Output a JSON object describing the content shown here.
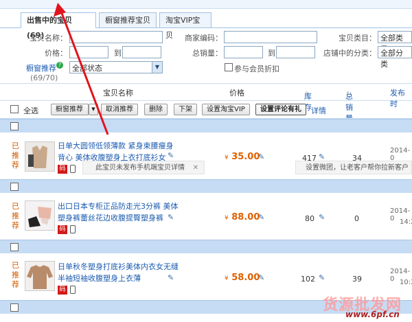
{
  "tabs": [
    {
      "label": "出售中的宝贝 (69)"
    },
    {
      "label": "橱窗推荐宝贝"
    },
    {
      "label": "淘宝VIP宝贝"
    }
  ],
  "filters": {
    "name_label": "宝贝名称：",
    "code_label": "商家编码：",
    "category_label": "宝贝类目：",
    "category_value": "全部类目",
    "price_label": "价格：",
    "to1": "到",
    "sales_label": "总销量：",
    "to2": "到",
    "shop_cat_label": "店铺中的分类：",
    "shop_cat_value": "全部分类",
    "window_label": "橱窗推荐",
    "window_value": "全部状态",
    "window_count": "(69/70)",
    "member_discount": "参与会员折扣"
  },
  "table_header": {
    "name": "宝贝名称",
    "price": "价格",
    "stock": "库存",
    "sales": "总销量",
    "publish": "发布时"
  },
  "toolbar": {
    "select_all": "全选",
    "window_rec": "橱窗推荐",
    "cancel_rec": "取消推荐",
    "delete": "删除",
    "unlist": "下架",
    "set_vip": "设置淘宝VIP",
    "set_gift": "设置评论有礼",
    "detail": "详情"
  },
  "items": [
    {
      "rec": "已推荐",
      "title": "日单大圆领低领薄款 紧身束腰瘦身背心 美体收腹塑身上衣打底衫女",
      "badge": "码",
      "price": "35.00",
      "currency": "¥",
      "stock": "417",
      "sales": "34",
      "date": "2014-0",
      "tip_left": "此宝贝未发布手机端宝贝详情",
      "tip_close": "✕",
      "tip_right": "设置微团，让老客户帮你拉新客户"
    },
    {
      "rec": "已推荐",
      "title": "出口日本专柜正品防走光3分裤 美体塑身裤蕾丝花边收腹提臀塑身裤",
      "badge": "码",
      "price": "88.00",
      "currency": "¥",
      "stock": "80",
      "sales": "0",
      "date": "2014-0",
      "time": "14:2"
    },
    {
      "rec": "已推荐",
      "title": "日单秋冬塑身打底衫美体内衣女无缝半袖短袖收腹塑身上衣薄",
      "badge": "码",
      "price": "58.00",
      "currency": "¥",
      "stock": "102",
      "sales": "39",
      "date": "2014-0",
      "time": "10:2"
    }
  ],
  "watermark": {
    "brand": "货源批发网",
    "url": "www.6pf.cn"
  },
  "colors": {
    "accent_blue": "#1b5bb0",
    "price_orange": "#e06000",
    "band_blue": "#c6dcf4",
    "arrow_red": "#e0141c"
  }
}
